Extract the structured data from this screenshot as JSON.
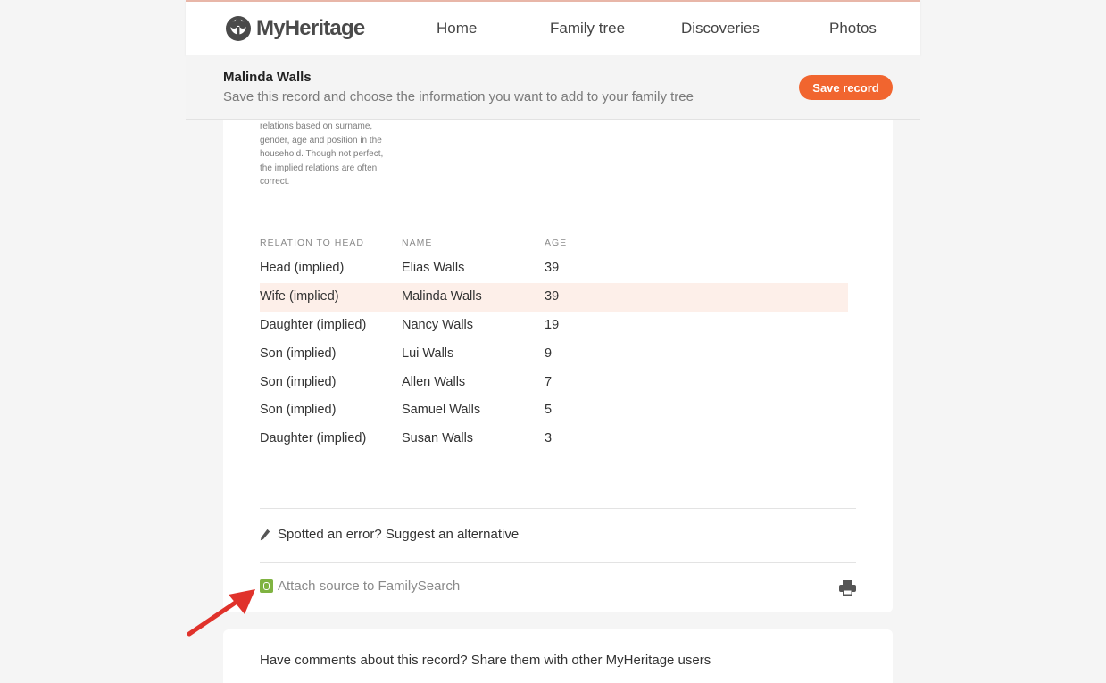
{
  "nav": {
    "brand": "MyHeritage",
    "items": [
      "Home",
      "Family tree",
      "Discoveries",
      "Photos"
    ]
  },
  "record": {
    "title": "Malinda Walls",
    "subtitle": "Save this record and choose the information you want to add to your family tree",
    "save_label": "Save record"
  },
  "household": {
    "note": "relations based on surname, gender, age and position in the household. Though not perfect, the implied relations are often correct.",
    "columns": [
      "RELATION TO HEAD",
      "NAME",
      "AGE"
    ],
    "rows": [
      {
        "relation": "Head (implied)",
        "name": "Elias Walls",
        "age": "39"
      },
      {
        "relation": "Wife (implied)",
        "name": "Malinda Walls",
        "age": "39"
      },
      {
        "relation": "Daughter (implied)",
        "name": "Nancy Walls",
        "age": "19"
      },
      {
        "relation": "Son (implied)",
        "name": "Lui Walls",
        "age": "9"
      },
      {
        "relation": "Son (implied)",
        "name": "Allen Walls",
        "age": "7"
      },
      {
        "relation": "Son (implied)",
        "name": "Samuel Walls",
        "age": "5"
      },
      {
        "relation": "Daughter (implied)",
        "name": "Susan Walls",
        "age": "3"
      }
    ],
    "highlighted_row": 1
  },
  "actions": {
    "suggest_label": "Spotted an error? Suggest an alternative",
    "attach_label": "Attach source to FamilySearch"
  },
  "comments": {
    "prompt": "Have comments about this record? Share them with other MyHeritage users"
  },
  "colors": {
    "accent": "#f1652f",
    "highlight_row": "#fdefe9",
    "familysearch_green": "#7fb341",
    "annotation_arrow": "#e0322b"
  }
}
